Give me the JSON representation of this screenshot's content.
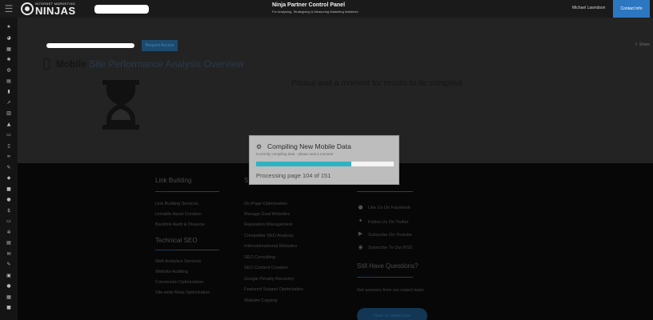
{
  "header": {
    "logo_small": "INTERNET MARKETING",
    "logo_big": "NINJAS",
    "panel_title": "Ninja Partner Control Panel",
    "panel_subtitle": "For Analysing, Strategising & Measuring Marketing Initiatives",
    "user_name": "Michael Lawndson",
    "contact_label": "Contact Info"
  },
  "sidebar": {
    "icons": [
      "menu-icon",
      "star-icon",
      "dashboard-icon",
      "calendar-icon",
      "puzzle-icon",
      "palette-icon",
      "map-icon",
      "bar-chart-icon",
      "line-chart-icon",
      "pages-icon",
      "road-icon",
      "laptop-icon",
      "mobile-icon",
      "link-icon",
      "pencil-icon",
      "tag-icon",
      "video-icon",
      "chat-icon",
      "dollar-icon",
      "file-icon",
      "settings-icon",
      "document-icon",
      "mail-icon",
      "edit-icon",
      "lock-icon",
      "info-icon",
      "keyboard-icon",
      "camera-icon"
    ],
    "glyphs": [
      "☰",
      "★",
      "◕",
      "▦",
      "✱",
      "◍",
      "▤",
      "▮",
      "↗",
      "▥",
      "▲",
      "▭",
      "▯",
      "∞",
      "✎",
      "◆",
      "■",
      "●",
      "$",
      "▭",
      "✲",
      "▤",
      "✉",
      "✎",
      "▣",
      "●",
      "▦",
      "■"
    ]
  },
  "main": {
    "action_button": "Request Access",
    "share_label": "Share",
    "title_bold": "Mobile",
    "title_rest": " Site Performance Analysis Overview",
    "wait_message": "Please wait a moment for results to be compiled"
  },
  "footer": {
    "col1_head1": "Link Building",
    "col1_links1": [
      "Link Building Services",
      "Linkable Asset Creation",
      "Backlink Audit & Disavow"
    ],
    "col1_head2": "Technical SEO",
    "col1_links2": [
      "Web Analytics Services",
      "Website Auditing",
      "Conversion Optimization",
      "Site-wide Meta Optimization"
    ],
    "col2_head": "S",
    "col2_links": [
      "On-Page Optimization",
      "Manage Goal Websites",
      "Reputation Management",
      "Competitor SEO Analysis",
      "Internationational Websites",
      "SEO Consulting",
      "SEO Content Creation",
      "Google Penalty Recovery",
      "Featured Snippet Optimization",
      "Website Copying"
    ],
    "social_links": [
      "Like Us On Facebook",
      "Follow Us On Twitter",
      "Subscribe On Youtube",
      "Subscribe To Our RSS"
    ],
    "questions_head": "Still Have Questions?",
    "questions_text": "Get answers from our expert team",
    "cta_label": "Have us contact you"
  },
  "modal": {
    "title": "Compiling New Mobile Data",
    "subtitle": "Currently compiling data - please wait a moment",
    "progress_fraction": 0.689,
    "status": "Processing page 104 of 151"
  },
  "colors": {
    "accent": "#2d77c1",
    "progress": "#2fb3c3"
  }
}
